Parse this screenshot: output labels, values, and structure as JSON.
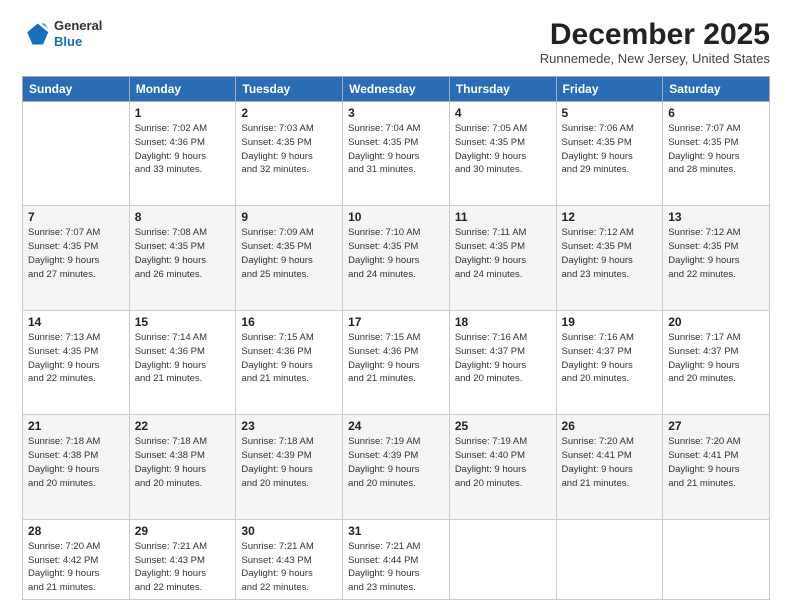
{
  "header": {
    "logo_general": "General",
    "logo_blue": "Blue",
    "month_title": "December 2025",
    "location": "Runnemede, New Jersey, United States"
  },
  "weekdays": [
    "Sunday",
    "Monday",
    "Tuesday",
    "Wednesday",
    "Thursday",
    "Friday",
    "Saturday"
  ],
  "weeks": [
    [
      {
        "day": "",
        "info": ""
      },
      {
        "day": "1",
        "info": "Sunrise: 7:02 AM\nSunset: 4:36 PM\nDaylight: 9 hours\nand 33 minutes."
      },
      {
        "day": "2",
        "info": "Sunrise: 7:03 AM\nSunset: 4:35 PM\nDaylight: 9 hours\nand 32 minutes."
      },
      {
        "day": "3",
        "info": "Sunrise: 7:04 AM\nSunset: 4:35 PM\nDaylight: 9 hours\nand 31 minutes."
      },
      {
        "day": "4",
        "info": "Sunrise: 7:05 AM\nSunset: 4:35 PM\nDaylight: 9 hours\nand 30 minutes."
      },
      {
        "day": "5",
        "info": "Sunrise: 7:06 AM\nSunset: 4:35 PM\nDaylight: 9 hours\nand 29 minutes."
      },
      {
        "day": "6",
        "info": "Sunrise: 7:07 AM\nSunset: 4:35 PM\nDaylight: 9 hours\nand 28 minutes."
      }
    ],
    [
      {
        "day": "7",
        "info": "Sunrise: 7:07 AM\nSunset: 4:35 PM\nDaylight: 9 hours\nand 27 minutes."
      },
      {
        "day": "8",
        "info": "Sunrise: 7:08 AM\nSunset: 4:35 PM\nDaylight: 9 hours\nand 26 minutes."
      },
      {
        "day": "9",
        "info": "Sunrise: 7:09 AM\nSunset: 4:35 PM\nDaylight: 9 hours\nand 25 minutes."
      },
      {
        "day": "10",
        "info": "Sunrise: 7:10 AM\nSunset: 4:35 PM\nDaylight: 9 hours\nand 24 minutes."
      },
      {
        "day": "11",
        "info": "Sunrise: 7:11 AM\nSunset: 4:35 PM\nDaylight: 9 hours\nand 24 minutes."
      },
      {
        "day": "12",
        "info": "Sunrise: 7:12 AM\nSunset: 4:35 PM\nDaylight: 9 hours\nand 23 minutes."
      },
      {
        "day": "13",
        "info": "Sunrise: 7:12 AM\nSunset: 4:35 PM\nDaylight: 9 hours\nand 22 minutes."
      }
    ],
    [
      {
        "day": "14",
        "info": "Sunrise: 7:13 AM\nSunset: 4:35 PM\nDaylight: 9 hours\nand 22 minutes."
      },
      {
        "day": "15",
        "info": "Sunrise: 7:14 AM\nSunset: 4:36 PM\nDaylight: 9 hours\nand 21 minutes."
      },
      {
        "day": "16",
        "info": "Sunrise: 7:15 AM\nSunset: 4:36 PM\nDaylight: 9 hours\nand 21 minutes."
      },
      {
        "day": "17",
        "info": "Sunrise: 7:15 AM\nSunset: 4:36 PM\nDaylight: 9 hours\nand 21 minutes."
      },
      {
        "day": "18",
        "info": "Sunrise: 7:16 AM\nSunset: 4:37 PM\nDaylight: 9 hours\nand 20 minutes."
      },
      {
        "day": "19",
        "info": "Sunrise: 7:16 AM\nSunset: 4:37 PM\nDaylight: 9 hours\nand 20 minutes."
      },
      {
        "day": "20",
        "info": "Sunrise: 7:17 AM\nSunset: 4:37 PM\nDaylight: 9 hours\nand 20 minutes."
      }
    ],
    [
      {
        "day": "21",
        "info": "Sunrise: 7:18 AM\nSunset: 4:38 PM\nDaylight: 9 hours\nand 20 minutes."
      },
      {
        "day": "22",
        "info": "Sunrise: 7:18 AM\nSunset: 4:38 PM\nDaylight: 9 hours\nand 20 minutes."
      },
      {
        "day": "23",
        "info": "Sunrise: 7:18 AM\nSunset: 4:39 PM\nDaylight: 9 hours\nand 20 minutes."
      },
      {
        "day": "24",
        "info": "Sunrise: 7:19 AM\nSunset: 4:39 PM\nDaylight: 9 hours\nand 20 minutes."
      },
      {
        "day": "25",
        "info": "Sunrise: 7:19 AM\nSunset: 4:40 PM\nDaylight: 9 hours\nand 20 minutes."
      },
      {
        "day": "26",
        "info": "Sunrise: 7:20 AM\nSunset: 4:41 PM\nDaylight: 9 hours\nand 21 minutes."
      },
      {
        "day": "27",
        "info": "Sunrise: 7:20 AM\nSunset: 4:41 PM\nDaylight: 9 hours\nand 21 minutes."
      }
    ],
    [
      {
        "day": "28",
        "info": "Sunrise: 7:20 AM\nSunset: 4:42 PM\nDaylight: 9 hours\nand 21 minutes."
      },
      {
        "day": "29",
        "info": "Sunrise: 7:21 AM\nSunset: 4:43 PM\nDaylight: 9 hours\nand 22 minutes."
      },
      {
        "day": "30",
        "info": "Sunrise: 7:21 AM\nSunset: 4:43 PM\nDaylight: 9 hours\nand 22 minutes."
      },
      {
        "day": "31",
        "info": "Sunrise: 7:21 AM\nSunset: 4:44 PM\nDaylight: 9 hours\nand 23 minutes."
      },
      {
        "day": "",
        "info": ""
      },
      {
        "day": "",
        "info": ""
      },
      {
        "day": "",
        "info": ""
      }
    ]
  ]
}
